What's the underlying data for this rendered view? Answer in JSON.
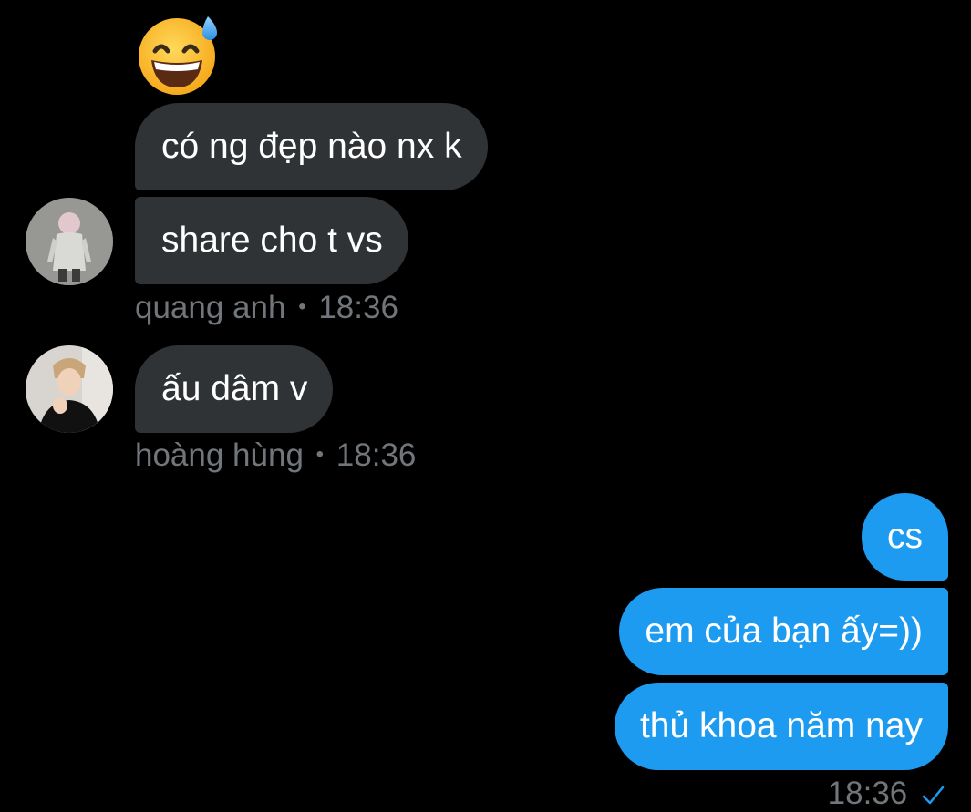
{
  "reaction_emoji": "grinning-face-with-sweat-icon",
  "incoming": [
    {
      "text": "có ng đẹp nào nx k"
    },
    {
      "text": "share cho t vs"
    },
    {
      "text": "ấu dâm v"
    }
  ],
  "incoming_meta": [
    {
      "sender": "quang anh",
      "separator": "•",
      "time": "18:36"
    },
    {
      "sender": "hoàng hùng",
      "separator": "•",
      "time": "18:36"
    }
  ],
  "outgoing": [
    {
      "text": "cs"
    },
    {
      "text": "em của bạn ấy=))"
    },
    {
      "text": "thủ khoa năm nay"
    }
  ],
  "outgoing_meta": {
    "time": "18:36",
    "status_icon": "sent-check-icon"
  },
  "colors": {
    "background": "#000000",
    "incoming_bubble": "#2f3336",
    "outgoing_bubble": "#1d9bf0",
    "meta_text": "#71767b"
  }
}
